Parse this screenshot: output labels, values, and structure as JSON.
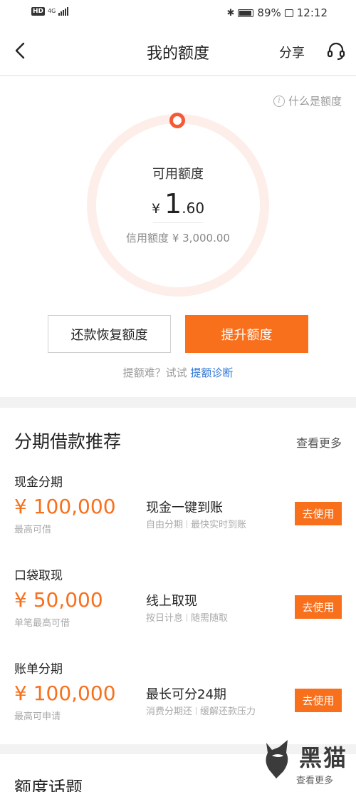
{
  "status_bar": {
    "hd": "HD",
    "network": "4G",
    "battery": "89%",
    "time": "12:12"
  },
  "nav": {
    "title": "我的额度",
    "share": "分享"
  },
  "quota": {
    "what_is": "什么是额度",
    "available_label": "可用额度",
    "currency": "¥",
    "amount_int": "1",
    "amount_dec": ".60",
    "credit_line": "信用额度 ¥ 3,000.00",
    "repay_button": "还款恢复额度",
    "raise_button": "提升额度",
    "hint_prefix": "提额难？试试 ",
    "hint_link": "提额诊断"
  },
  "loans": {
    "title": "分期借款推荐",
    "see_more": "查看更多",
    "items": [
      {
        "name": "现金分期",
        "amount": "¥ 100,000",
        "sub": "最高可借",
        "feature": "现金一键到账",
        "tag1": "自由分期",
        "tag2": "最快实时到账",
        "button": "去使用"
      },
      {
        "name": "口袋取现",
        "amount": "¥ 50,000",
        "sub": "单笔最高可借",
        "feature": "线上取现",
        "tag1": "按日计息",
        "tag2": "随需随取",
        "button": "去使用"
      },
      {
        "name": "账单分期",
        "amount": "¥ 100,000",
        "sub": "最高可申请",
        "feature": "最长可分24期",
        "tag1": "消费分期还",
        "tag2": "缓解还款压力",
        "button": "去使用"
      }
    ]
  },
  "topics": {
    "title": "额度话题"
  },
  "watermark": {
    "text": "黑猫",
    "sub": "查看更多"
  },
  "colors": {
    "accent": "#f8701c",
    "ring": "#fdeee9",
    "ring_dot": "#f45a37",
    "link": "#2a74d6"
  }
}
